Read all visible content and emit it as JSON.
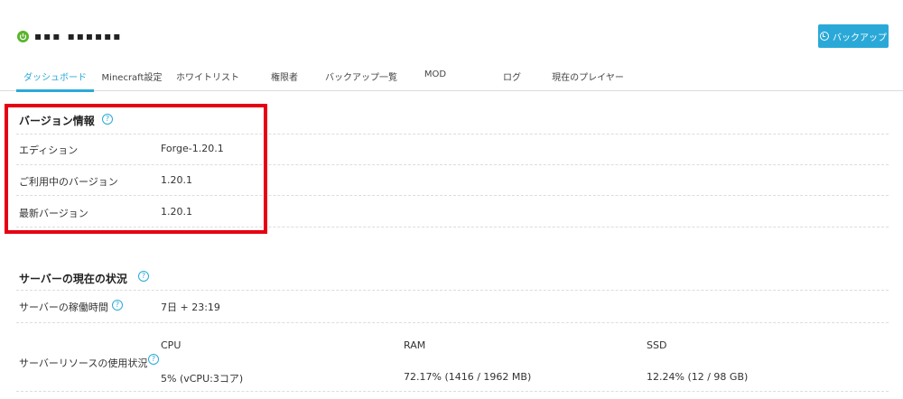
{
  "header": {
    "server_name": "▪▪▪ ▪▪▪▪▪▪",
    "backup_button": "バックアップ"
  },
  "tabs": [
    {
      "label": "ダッシュボード",
      "active": true
    },
    {
      "label": "Minecraft設定"
    },
    {
      "label": "ホワイトリスト"
    },
    {
      "label": "権限者"
    },
    {
      "label": "バックアップ一覧"
    },
    {
      "label": "MOD"
    },
    {
      "label": "ログ"
    },
    {
      "label": "現在のプレイヤー"
    }
  ],
  "version_info": {
    "title": "バージョン情報",
    "rows": [
      {
        "label": "エディション",
        "value": "Forge-1.20.1"
      },
      {
        "label": "ご利用中のバージョン",
        "value": "1.20.1"
      },
      {
        "label": "最新バージョン",
        "value": "1.20.1"
      }
    ]
  },
  "server_status": {
    "title": "サーバーの現在の状況",
    "uptime_label": "サーバーの稼働時間",
    "uptime_value": "7日 + 23:19",
    "resource_label": "サーバーリソースの使用状況",
    "cpu_header": "CPU",
    "ram_header": "RAM",
    "ssd_header": "SSD",
    "cpu_value": "5% (vCPU:3コア)",
    "ram_value": "72.17% (1416 / 1962 MB)",
    "ssd_value": "12.24% (12 / 98 GB)"
  },
  "icons": {
    "help": "?",
    "status_color": "#59b52c",
    "accent_color": "#2aa9d8",
    "highlight_color": "#e60012"
  }
}
